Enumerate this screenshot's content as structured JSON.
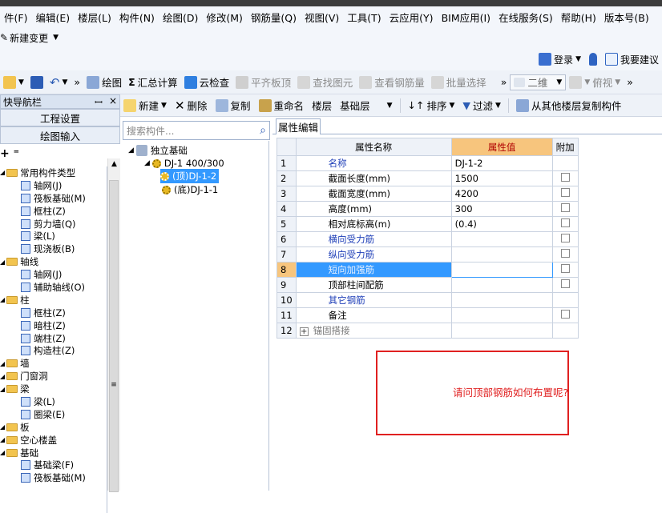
{
  "menu": [
    "件(F)",
    "编辑(E)",
    "楼层(L)",
    "构件(N)",
    "绘图(D)",
    "修改(M)",
    "钢筋量(Q)",
    "视图(V)",
    "工具(T)",
    "云应用(Y)",
    "BIM应用(I)",
    "在线服务(S)",
    "帮助(H)",
    "版本号(B)"
  ],
  "change_label": "新建变更",
  "login_label": "登录",
  "suggest_label": "我要建议",
  "toolbar1": {
    "draw": "绘图",
    "sum_calc": "汇总计算",
    "cloud_check": "云检查",
    "flat_board": "平齐板顶",
    "find_elem": "查找图元",
    "view_rebar": "查看钢筋量",
    "batch_select": "批量选择",
    "view_mode": "二维",
    "view_dir": "俯视"
  },
  "nav": {
    "title": "快导航栏",
    "pin": "ꟷ",
    "close": "×",
    "project_settings": "工程设置",
    "draw_input": "绘图输入",
    "tree": [
      {
        "text": "常用构件类型",
        "level": 0,
        "folder": true
      },
      {
        "text": "轴网(J)",
        "level": 1
      },
      {
        "text": "筏板基础(M)",
        "level": 1
      },
      {
        "text": "框柱(Z)",
        "level": 1
      },
      {
        "text": "剪力墙(Q)",
        "level": 1
      },
      {
        "text": "梁(L)",
        "level": 1
      },
      {
        "text": "现浇板(B)",
        "level": 1
      },
      {
        "text": "轴线",
        "level": 0,
        "folder": true
      },
      {
        "text": "轴网(J)",
        "level": 1
      },
      {
        "text": "辅助轴线(O)",
        "level": 1
      },
      {
        "text": "柱",
        "level": 0,
        "folder": true
      },
      {
        "text": "框柱(Z)",
        "level": 1
      },
      {
        "text": "暗柱(Z)",
        "level": 1
      },
      {
        "text": "端柱(Z)",
        "level": 1
      },
      {
        "text": "构造柱(Z)",
        "level": 1
      },
      {
        "text": "墙",
        "level": 0,
        "folder": true
      },
      {
        "text": "门窗洞",
        "level": 0,
        "folder": true
      },
      {
        "text": "梁",
        "level": 0,
        "folder": true
      },
      {
        "text": "梁(L)",
        "level": 1
      },
      {
        "text": "圈梁(E)",
        "level": 1
      },
      {
        "text": "板",
        "level": 0,
        "folder": true
      },
      {
        "text": "空心楼盖",
        "level": 0,
        "folder": true
      },
      {
        "text": "基础",
        "level": 0,
        "folder": true
      },
      {
        "text": "基础梁(F)",
        "level": 1
      },
      {
        "text": "筏板基础(M)",
        "level": 1
      }
    ]
  },
  "toolbar2": {
    "new": "新建",
    "delete": "删除",
    "copy": "复制",
    "rename": "重命名",
    "floor_label": "楼层",
    "floor_value": "基础层",
    "sort": "排序",
    "filter": "过滤",
    "copy_from_floor": "从其他楼层复制构件"
  },
  "search_placeholder": "搜索构件...",
  "component_tree": {
    "root": "独立基础",
    "dj": "DJ-1 400/300",
    "top": "(顶)DJ-1-2",
    "bottom": "(底)DJ-1-1"
  },
  "prop_tab": "属性编辑",
  "grid": {
    "headers": [
      "属性名称",
      "属性值",
      "附加"
    ],
    "rows": [
      {
        "n": "1",
        "name": "名称",
        "value": "DJ-1-2",
        "blue": true,
        "check": false
      },
      {
        "n": "2",
        "name": "截面长度(mm)",
        "value": "1500",
        "blue": false,
        "check": true
      },
      {
        "n": "3",
        "name": "截面宽度(mm)",
        "value": "4200",
        "blue": false,
        "check": true
      },
      {
        "n": "4",
        "name": "高度(mm)",
        "value": "300",
        "blue": false,
        "check": true
      },
      {
        "n": "5",
        "name": "相对底标高(m)",
        "value": "(0.4)",
        "blue": false,
        "check": true
      },
      {
        "n": "6",
        "name": "横向受力筋",
        "value": "",
        "blue": true,
        "check": true
      },
      {
        "n": "7",
        "name": "纵向受力筋",
        "value": "",
        "blue": true,
        "check": true
      },
      {
        "n": "8",
        "name": "短向加强筋",
        "value": "",
        "blue": true,
        "check": true,
        "selected": true
      },
      {
        "n": "9",
        "name": "顶部柱间配筋",
        "value": "",
        "blue": false,
        "check": true
      },
      {
        "n": "10",
        "name": "其它钢筋",
        "value": "",
        "blue": true,
        "check": false
      },
      {
        "n": "11",
        "name": "备注",
        "value": "",
        "blue": false,
        "check": true
      },
      {
        "n": "12",
        "name": "锚固搭接",
        "value": "",
        "blue": false,
        "check": false,
        "expand": true,
        "gray": true
      }
    ]
  },
  "annotation": "请问顶部钢筋如何布置呢?",
  "colors": {
    "selection": "#3399ff",
    "header_value": "#f7c57d",
    "annotation_red": "#e02020",
    "blue_text": "#1f3fb8"
  }
}
